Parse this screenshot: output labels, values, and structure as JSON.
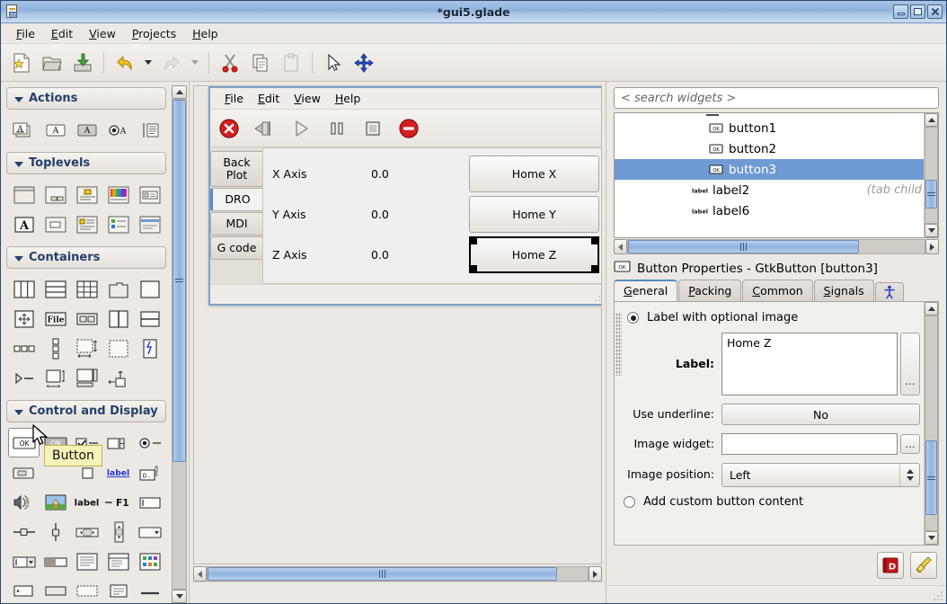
{
  "window": {
    "title": "*gui5.glade",
    "icon": "glade-document-icon",
    "minimize": "Minimize",
    "maximize": "Maximize",
    "close": "Close"
  },
  "menubar": [
    {
      "label": "File",
      "mnemonic": "F"
    },
    {
      "label": "Edit",
      "mnemonic": "E"
    },
    {
      "label": "View",
      "mnemonic": "V"
    },
    {
      "label": "Projects",
      "mnemonic": "P"
    },
    {
      "label": "Help",
      "mnemonic": "H"
    }
  ],
  "toolbar": [
    {
      "name": "new-button",
      "icon": "new-document-icon",
      "disabled": false
    },
    {
      "name": "open-button",
      "icon": "open-folder-icon",
      "disabled": false
    },
    {
      "name": "save-button",
      "icon": "save-disk-icon",
      "disabled": false
    },
    {
      "name": "undo-button",
      "icon": "undo-arrow-icon",
      "disabled": false
    },
    {
      "name": "redo-button",
      "icon": "redo-arrow-icon",
      "disabled": true
    },
    {
      "name": "cut-button",
      "icon": "scissors-icon",
      "disabled": false
    },
    {
      "name": "copy-button",
      "icon": "copy-icon",
      "disabled": false
    },
    {
      "name": "paste-button",
      "icon": "clipboard-icon",
      "disabled": true
    },
    {
      "name": "select-button",
      "icon": "pointer-arrow-icon",
      "disabled": false
    },
    {
      "name": "drag-resize-button",
      "icon": "move-arrows-icon",
      "disabled": false
    }
  ],
  "palette": {
    "sections": [
      {
        "title": "Actions",
        "expanded": true
      },
      {
        "title": "Toplevels",
        "expanded": true
      },
      {
        "title": "Containers",
        "expanded": true
      },
      {
        "title": "Control and Display",
        "expanded": true
      }
    ],
    "tooltip": "Button",
    "selected_widget": "button-widget"
  },
  "design": {
    "menubar": [
      {
        "label": "File",
        "mnemonic": "F"
      },
      {
        "label": "Edit",
        "mnemonic": "E"
      },
      {
        "label": "View",
        "mnemonic": "V"
      },
      {
        "label": "Help",
        "mnemonic": "H"
      }
    ],
    "toolbar": [
      {
        "name": "estop-button",
        "icon": "red-x-circle-icon"
      },
      {
        "name": "machine-power-button",
        "icon": "power-plug-icon"
      },
      {
        "name": "run-button",
        "icon": "play-triangle-icon"
      },
      {
        "name": "pause-button",
        "icon": "pause-bars-icon"
      },
      {
        "name": "stop-button",
        "icon": "stop-square-icon"
      },
      {
        "name": "abort-button",
        "icon": "red-minus-circle-icon"
      }
    ],
    "tabs": [
      {
        "label": "Back Plot",
        "active": false
      },
      {
        "label": "DRO",
        "active": true
      },
      {
        "label": "MDI",
        "active": false
      },
      {
        "label": "G code",
        "active": false
      }
    ],
    "axes": [
      {
        "label": "X Axis",
        "value": "0.0",
        "button": "Home X",
        "selected": false
      },
      {
        "label": "Y Axis",
        "value": "0.0",
        "button": "Home Y",
        "selected": false
      },
      {
        "label": "Z Axis",
        "value": "0.0",
        "button": "Home Z",
        "selected": true
      }
    ]
  },
  "inspector": {
    "search_placeholder": "< search widgets >",
    "search_value": "",
    "tree": [
      {
        "label": "button1",
        "icon": "button-widget-icon",
        "selected": false,
        "note": ""
      },
      {
        "label": "button2",
        "icon": "button-widget-icon",
        "selected": false,
        "note": ""
      },
      {
        "label": "button3",
        "icon": "button-widget-icon",
        "selected": true,
        "note": ""
      },
      {
        "label": "label2",
        "icon": "label-widget-icon",
        "selected": false,
        "note": "(tab child"
      },
      {
        "label": "label6",
        "icon": "label-widget-icon",
        "selected": false,
        "note": ""
      }
    ]
  },
  "properties": {
    "header": "Button Properties - GtkButton [button3]",
    "header_icon": "button-widget-icon",
    "tabs": [
      {
        "label": "General",
        "mnemonic": "G",
        "active": true
      },
      {
        "label": "Packing",
        "mnemonic": "P",
        "active": false
      },
      {
        "label": "Common",
        "mnemonic": "C",
        "active": false
      },
      {
        "label": "Signals",
        "mnemonic": "S",
        "active": false
      },
      {
        "label": "",
        "icon": "accessibility-icon",
        "active": false
      }
    ],
    "content_radio_label": "Label with optional image",
    "content_radio_selected": true,
    "label_field_label": "Label:",
    "label_field_value": "Home Z",
    "label_field_ellipsis": "...",
    "underline_label": "Use underline:",
    "underline_value": "No",
    "image_widget_label": "Image widget:",
    "image_widget_value": "",
    "image_widget_ellipsis": "...",
    "image_position_label": "Image position:",
    "image_position_value": "Left",
    "custom_radio_label": "Add custom button content",
    "custom_radio_selected": false,
    "footer_buttons": [
      {
        "name": "devhelp-button",
        "icon": "devhelp-d-icon"
      },
      {
        "name": "clear-properties-button",
        "icon": "broom-icon"
      }
    ]
  },
  "colors": {
    "titlebar_start": "#a8c4e4",
    "titlebar_end": "#cdddf0",
    "selection_blue": "#6f9ad3",
    "scrollbar_thumb": "#8fb3de",
    "section_text": "#24406b",
    "tooltip_bg": "#f7f3b8",
    "chrome_bg": "#ece9e4",
    "estop_red": "#d42020"
  }
}
